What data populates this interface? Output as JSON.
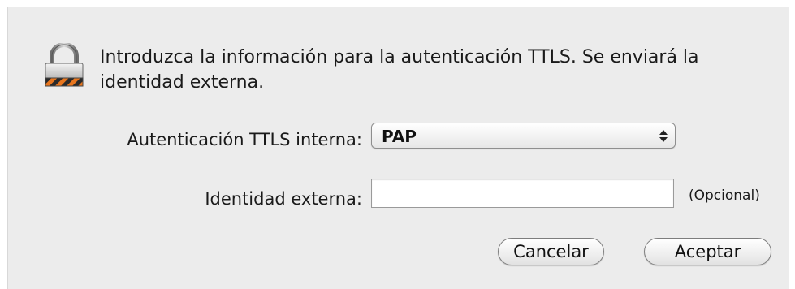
{
  "dialog": {
    "message": "Introduzca la información para la autenticación TTLS. Se enviará la identidad externa.",
    "icon": "lock-icon"
  },
  "form": {
    "auth_label": "Autenticación TTLS interna:",
    "auth_selected": "PAP",
    "identity_label": "Identidad externa:",
    "identity_value": "",
    "identity_hint": "(Opcional)"
  },
  "buttons": {
    "cancel_label": "Cancelar",
    "ok_label": "Aceptar"
  },
  "colors": {
    "background": "#ececec",
    "lock_stripe_orange": "#e8761e",
    "lock_stripe_dark": "#2a2a2a"
  }
}
